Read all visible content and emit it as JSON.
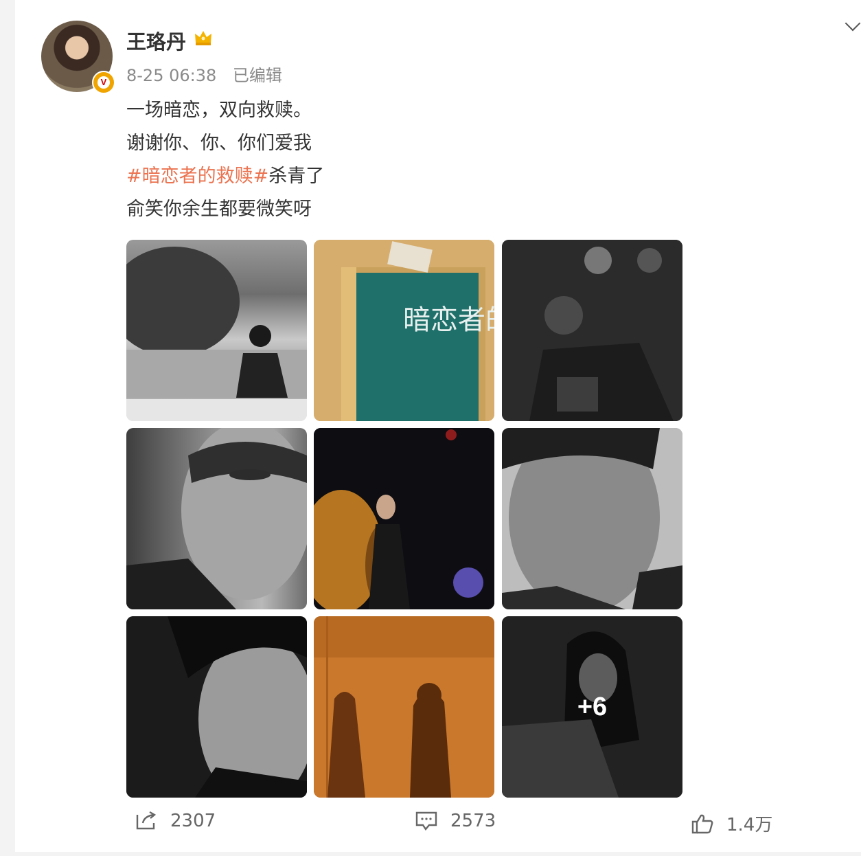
{
  "post": {
    "author": "王珞丹",
    "timestamp": "8-25 06:38",
    "edited": "已编辑",
    "lines": [
      "一场暗恋，双向救赎。",
      "谢谢你、你、你们爱我",
      "俞笑你余生都要微笑呀"
    ],
    "hashtag": "#暗恋者的救赎#",
    "hashtag_suffix": "杀青了",
    "more_images": "+6",
    "script_cover_title": "暗恋者的救赎"
  },
  "actions": {
    "repost_count": "2307",
    "comment_count": "2573",
    "like_count": "1.4万"
  },
  "icons": [
    "chevron-down-icon",
    "verified-badge-icon",
    "crown-icon",
    "repost-icon",
    "comment-icon",
    "like-icon"
  ],
  "colors": {
    "hashtag": "#eb7350",
    "badge": "#f0a400"
  }
}
